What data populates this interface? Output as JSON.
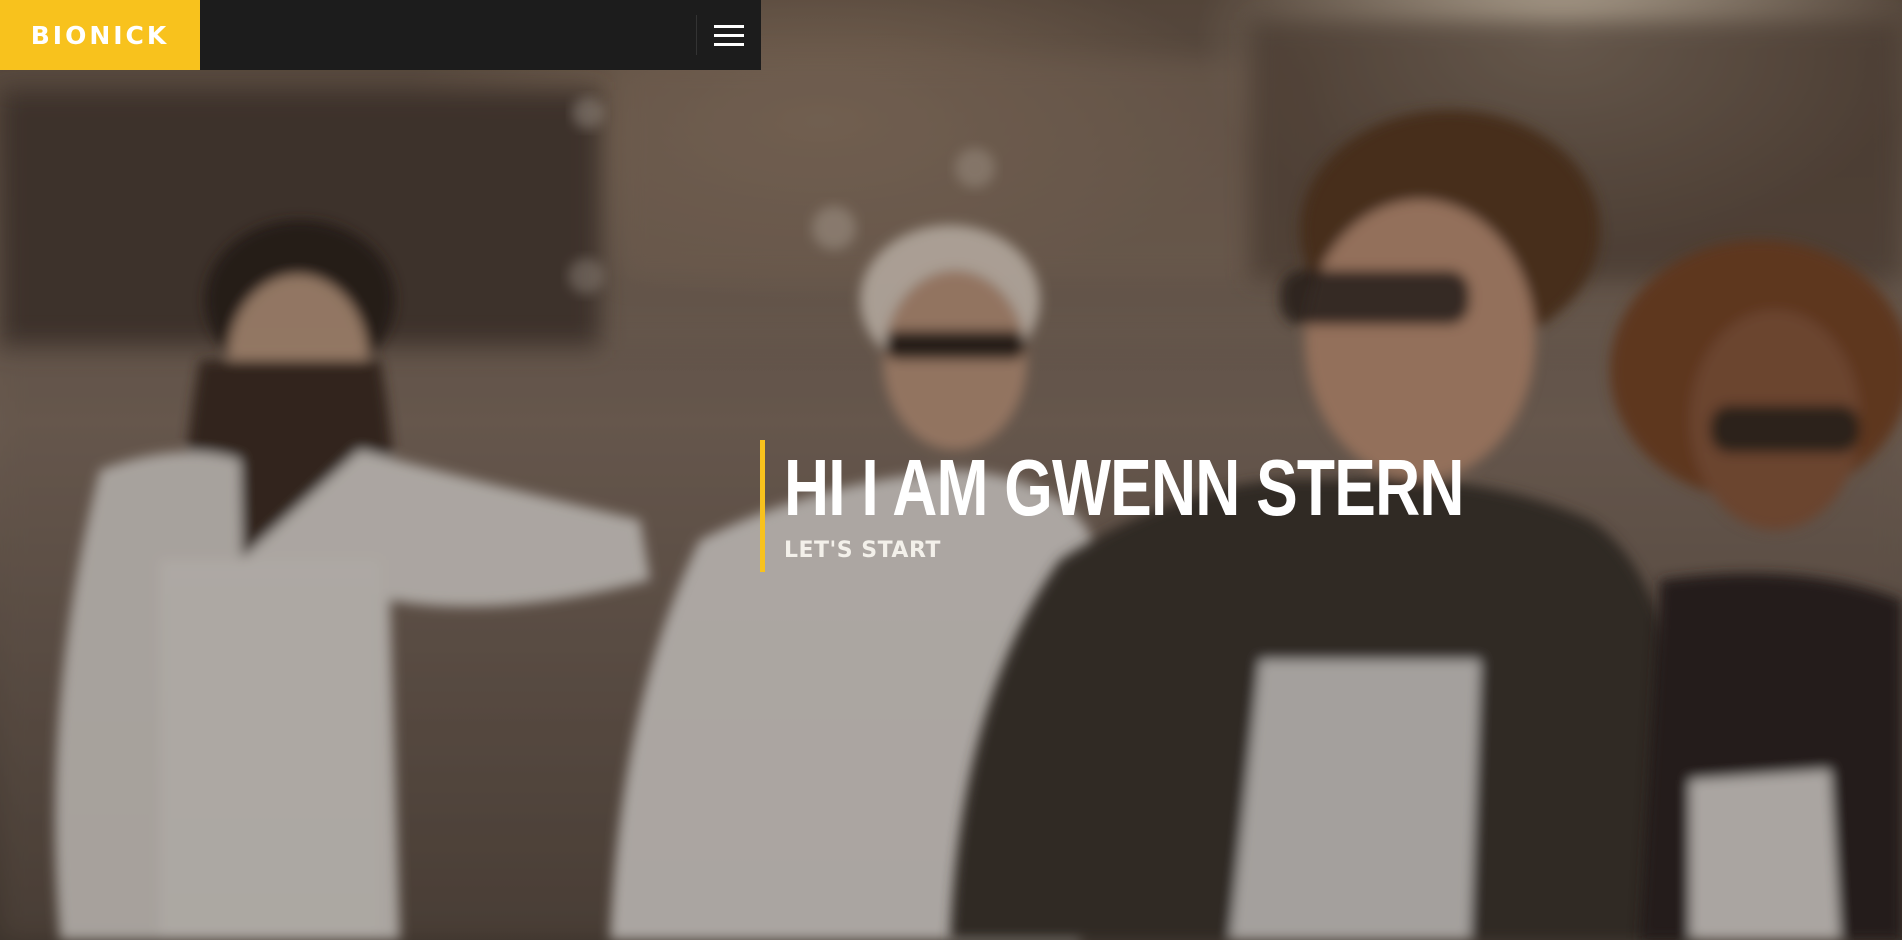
{
  "navbar": {
    "logo_text": "BIONICK",
    "menu_icon": "hamburger-menu-icon"
  },
  "hero": {
    "title": "HI I AM GWENN STERN",
    "cta": "LET'S START"
  },
  "colors": {
    "accent": "#f8c21d",
    "navbar_bg": "#1c1c1c",
    "text": "#ffffff"
  }
}
